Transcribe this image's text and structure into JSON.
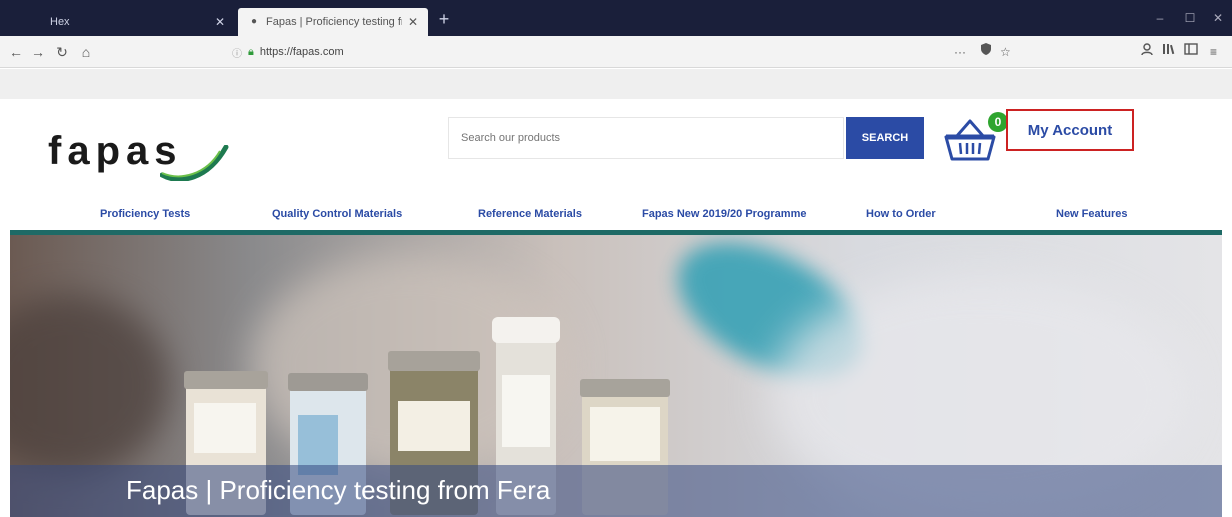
{
  "browser": {
    "tabs": [
      {
        "title": "Hex",
        "active": false
      },
      {
        "title": "Fapas | Proficiency testing fro",
        "active": true
      }
    ],
    "new_tab": "+",
    "window_controls": [
      "–",
      "☐",
      "✕"
    ],
    "url": "https://fapas.com",
    "url_actions": [
      "···",
      "shield-icon",
      "star-icon"
    ],
    "toolbar_icons": [
      "account-icon",
      "library-icon",
      "sidebar-icon",
      "menu-icon"
    ]
  },
  "site": {
    "logo_text": "fapas",
    "search": {
      "placeholder": "Search our products",
      "button_label": "SEARCH"
    },
    "basket_count": "0",
    "account_label": "My Account",
    "nav": [
      "Proficiency Tests",
      "Quality Control Materials",
      "Reference Materials",
      "Fapas New 2019/20 Programme",
      "How to Order",
      "New Features"
    ],
    "hero_caption": "Fapas | Proficiency testing from Fera"
  },
  "colors": {
    "brand_blue": "#2b4ba5",
    "accent_teal": "#1e6a66",
    "basket_green": "#2fa52f",
    "highlight_red": "#cc2222"
  }
}
